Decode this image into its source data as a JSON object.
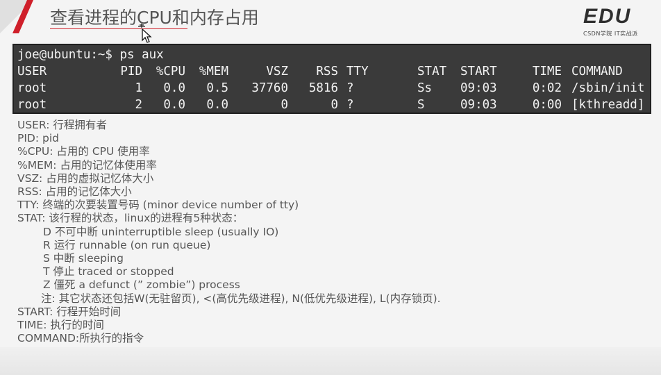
{
  "slide": {
    "title": "查看进程的CPU和内存占用",
    "logo": {
      "main": "EDU",
      "sub": "CSDN学院  IT实战派"
    }
  },
  "terminal": {
    "prompt": "joe@ubuntu:~$ ps aux",
    "header": [
      "USER",
      "PID",
      "%CPU",
      "%MEM",
      "VSZ",
      "RSS",
      "TTY",
      "STAT",
      "START",
      "TIME",
      "COMMAND"
    ],
    "rows": [
      [
        "root",
        "1",
        "0.0",
        "0.5",
        "37760",
        "5816",
        "?",
        "Ss",
        "09:03",
        "0:02",
        "/sbin/init"
      ],
      [
        "root",
        "2",
        "0.0",
        "0.0",
        "0",
        "0",
        "?",
        "S",
        "09:03",
        "0:00",
        "[kthreadd]"
      ]
    ]
  },
  "descriptions": [
    "USER: 行程拥有者",
    "PID: pid",
    "%CPU: 占用的 CPU 使用率",
    "%MEM: 占用的记忆体使用率",
    "VSZ: 占用的虚拟记忆体大小",
    "RSS: 占用的记忆体大小",
    "TTY: 终端的次要装置号码 (minor device number of tty)",
    "STAT: 该行程的状态，linux的进程有5种状态：",
    "D 不可中断 uninterruptible sleep (usually IO)",
    "R 运行 runnable (on run queue)",
    "S 中断 sleeping",
    "T 停止 traced or stopped",
    "Z 僵死 a defunct (” zombie”) process",
    "注: 其它状态还包括W(无驻留页), <(高优先级进程), N(低优先级进程), L(内存锁页).",
    "START: 行程开始时间",
    "TIME: 执行的时间",
    "COMMAND:所执行的指令"
  ],
  "colors": {
    "accent": "#cf1f2a",
    "terminal_bg": "#3a3a3a",
    "text": "#565656"
  }
}
